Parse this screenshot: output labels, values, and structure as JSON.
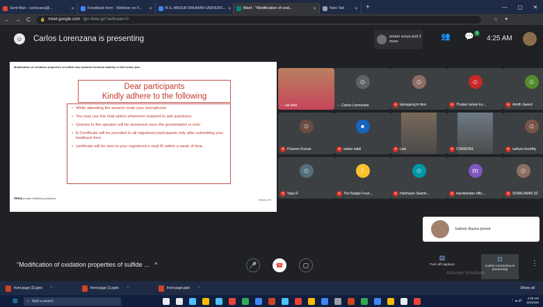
{
  "browser": {
    "tabs": [
      {
        "label": "Sent Mail - carlozana@...",
        "favicon_color": "#ea4335",
        "active": false
      },
      {
        "label": "Feedback form - Webinar on F...",
        "favicon_color": "#4285f4",
        "active": false
      },
      {
        "label": "B.S. ABDUR RAHMAN UNIVERS...",
        "favicon_color": "#4285f4",
        "active": false
      },
      {
        "label": "Meet - \"Modification of oxid...",
        "favicon_color": "#00897b",
        "active": true
      },
      {
        "label": "New Tab",
        "favicon_color": "#9aa0a6",
        "active": false
      }
    ],
    "url_domain": "meet.google.com",
    "url_path": "/gic-ihxw-go?authuser=0"
  },
  "header": {
    "presenting_text": "Carlos Lorenzana is presenting",
    "people_preview": "sriram surya and 3 more",
    "participants_badge": "9",
    "time": "4:25 AM"
  },
  "slide": {
    "title": "Modification of oxidation properties of sulfide wax towards frictional stability in NAO brake pad",
    "notice_title_line1": "Dear participants",
    "notice_title_line2": "Kindly adhere to the following",
    "items": [
      "While attending the session mute your microphone.",
      "You may use the chat option whenever required to ask questions.",
      "Queries to the speaker will be answered once the presentation is over.",
      "E-Certificate will be provided to all registered participants only after submitting your feedback form",
      "certificate will be sent to your registered e-mail ID within a week of time."
    ],
    "footer_brand": "rimsa",
    "footer_tagline": "people rethinking solutions",
    "footer_right": "rimsa.com"
  },
  "participants": [
    {
      "name": "sai bala",
      "kind": "video",
      "muted": false,
      "dots": true
    },
    {
      "name": "Carlos Lorenzana",
      "kind": "avatar",
      "muted": false,
      "dots": true,
      "avatar_color": "#5f6368",
      "glyph": "☺"
    },
    {
      "name": "kanagaraj.m devi",
      "kind": "avatar",
      "muted": true,
      "avatar_color": "#8d6e63",
      "glyph": "☺"
    },
    {
      "name": "Thulasi raman ku...",
      "kind": "avatar",
      "muted": true,
      "avatar_color": "#c62828",
      "glyph": "☺"
    },
    {
      "name": "Amith Jawed",
      "kind": "avatar",
      "muted": true,
      "avatar_color": "#558b2f",
      "glyph": "☺"
    },
    {
      "name": "Praveen Kumar",
      "kind": "avatar",
      "muted": true,
      "avatar_color": "#6d4c41",
      "glyph": "☺"
    },
    {
      "name": "sultan nabil",
      "kind": "avatar",
      "muted": true,
      "avatar_color": "#1565c0",
      "glyph": "●"
    },
    {
      "name": "Lalu",
      "kind": "video",
      "muted": true
    },
    {
      "name": "CHANDRA",
      "kind": "video",
      "muted": true
    },
    {
      "name": "sathya moorthy",
      "kind": "avatar",
      "muted": true,
      "avatar_color": "#795548",
      "glyph": "☺"
    },
    {
      "name": "Vijay R",
      "kind": "avatar",
      "muted": true,
      "avatar_color": "#546e7a",
      "glyph": "☺"
    },
    {
      "name": "The Nudge Foun...",
      "kind": "avatar",
      "muted": true,
      "avatar_color": "#fbc02d",
      "glyph": "/"
    },
    {
      "name": "Hariharan Swami...",
      "kind": "avatar",
      "muted": true,
      "avatar_color": "#0097a7",
      "glyph": "☺"
    },
    {
      "name": "manikandan offic...",
      "kind": "avatar",
      "muted": true,
      "avatar_color": "#7e57c2",
      "glyph": "m"
    },
    {
      "name": "SIVAKUMAR SC",
      "kind": "avatar",
      "muted": true,
      "avatar_color": "#8d6e63",
      "glyph": "☺"
    }
  ],
  "toast": {
    "text": "Sathick Basha joined"
  },
  "controls": {
    "meeting_title": "\"Modification of oxidation properties of sulfide ...",
    "captions_label": "Turn off captions",
    "presenting_label": "Carlos Lorenzana is presenting",
    "watermark": "Activate Windows"
  },
  "downloads": {
    "items": [
      "front page (2).pptx",
      "front page (1).pptx",
      "front page.pptx"
    ],
    "show_all": "Show all"
  },
  "taskbar": {
    "search_placeholder": "Start a search",
    "clock_time": "4:25 AM",
    "clock_date": "6/4/2020",
    "icon_colors": [
      "#e8eaed",
      "#e8eaed",
      "#4cc2ff",
      "#fbbc04",
      "#4cc2ff",
      "#ea4335",
      "#34a853",
      "#4285f4",
      "#d04423",
      "#4cc2ff",
      "#ea4335",
      "#fbbc04",
      "#4285f4",
      "#9aa0a6",
      "#d04423",
      "#34a853",
      "#4285f4",
      "#fbbc04",
      "#e8eaed",
      "#ea4335"
    ]
  }
}
